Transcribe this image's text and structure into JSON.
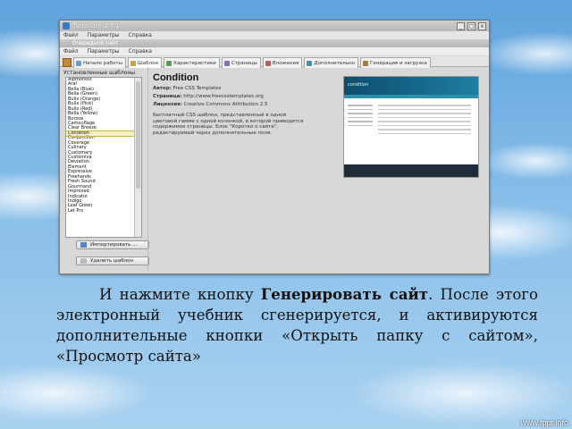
{
  "window": {
    "title": "TurboSite 1.7.1",
    "subtitle": "Очередной сайт",
    "controls": [
      "_",
      "□",
      "x"
    ]
  },
  "menu": {
    "primary": [
      "Файл",
      "Параметры",
      "Справка"
    ],
    "secondary": [
      "Файл",
      "Параметры",
      "Справка"
    ]
  },
  "tabs": [
    {
      "label": "Начало работы"
    },
    {
      "label": "Шаблон"
    },
    {
      "label": "Характеристики"
    },
    {
      "label": "Страницы"
    },
    {
      "label": "Вложения"
    },
    {
      "label": "Дополнительно"
    },
    {
      "label": "Генерация и загрузка"
    }
  ],
  "templates": {
    "heading": "Установленные шаблоны",
    "items": [
      "Alpmohost",
      "Aral",
      "Bella (Blue)",
      "Bella (Green)",
      "Bulix (Orange)",
      "Bulix (Pink)",
      "Bulix (Red)",
      "Bella (Yellow)",
      "Borzoe",
      "Camouflage",
      "Clear Breeze",
      "Condition",
      "Conjunction",
      "Coverage",
      "Culinary",
      "Customary",
      "Customiva",
      "Deviation",
      "Element",
      "Expressive",
      "Freehands",
      "Fresh Sound",
      "Gourmand",
      "Improved",
      "Indicator",
      "Indigo",
      "Leaf Green",
      "Let Pro"
    ],
    "selected_index": 11
  },
  "buttons": {
    "import": "Импортировать ...",
    "delete": "Удалить шаблон"
  },
  "template_info": {
    "name": "Condition",
    "author_label": "Автор:",
    "author": "Free CSS Templates",
    "source_label": "Страница:",
    "source": "http://www.freecsstemplates.org",
    "license_label": "Лицензия:",
    "license": "Creative Commons Attribution 2.5",
    "description": "Бесплатный CSS шаблон, представленный в одной цветовой гамме с одной колонкой, в которой приводится содержимое страницы. Блок \"Коротко о сайте\", редактируемый через дополнительные поля."
  },
  "preview": {
    "logo": "condition"
  },
  "caption": {
    "before": "И нажмите кнопку ",
    "bold": "Генерировать сайт",
    "after": ". После этого электронный учебник сгенерируется, и активируются дополнительные кнопки «Открыть папку с сайтом», «Просмотр сайта»"
  },
  "footer": "www.fppt.info"
}
